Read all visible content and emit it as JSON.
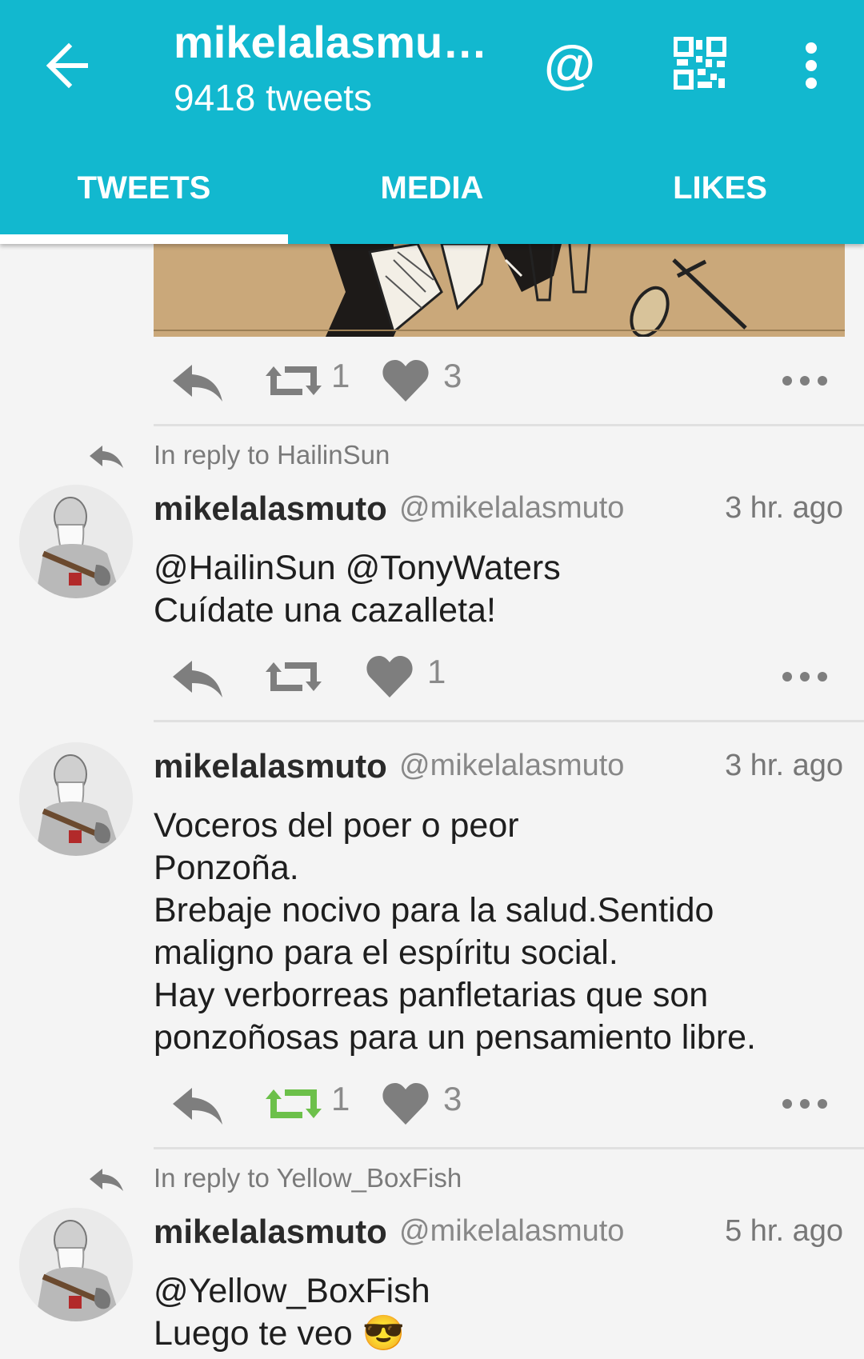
{
  "header": {
    "title": "mikelalasmu…",
    "subtitle": "9418 tweets",
    "at_symbol": "@",
    "icons": [
      "back-arrow-icon",
      "at-icon",
      "qr-code-icon",
      "overflow-menu-icon"
    ]
  },
  "tabs": [
    {
      "label": "TWEETS",
      "selected": true
    },
    {
      "label": "MEDIA",
      "selected": false
    },
    {
      "label": "LIKES",
      "selected": false
    }
  ],
  "colors": {
    "accent": "#12b8cf",
    "retweet_active": "#6cc04a",
    "icon_gray": "#8a8a8a"
  },
  "feed": {
    "partial_tweet": {
      "retweets": "1",
      "likes": "3"
    },
    "tweets": [
      {
        "reply_to": "In reply to HailinSun",
        "name": "mikelalasmuto",
        "handle": "@mikelalasmuto",
        "time": "3 hr. ago",
        "text": "@HailinSun @TonyWaters\nCuídate una cazalleta!",
        "retweets": "",
        "likes": "1"
      },
      {
        "reply_to": "",
        "name": "mikelalasmuto",
        "handle": "@mikelalasmuto",
        "time": "3 hr. ago",
        "text": "Voceros del poer o peor\nPonzoña.\nBrebaje nocivo para la salud.Sentido\nmaligno para el espíritu social.\nHay verborreas panfletarias que son\nponzoñosas para un pensamiento libre.",
        "retweets": "1",
        "retweeted": true,
        "likes": "3"
      },
      {
        "reply_to": "In reply to Yellow_BoxFish",
        "name": "mikelalasmuto",
        "handle": "@mikelalasmuto",
        "time": "5 hr. ago",
        "text": "@Yellow_BoxFish\nLuego te veo 😎"
      }
    ]
  }
}
